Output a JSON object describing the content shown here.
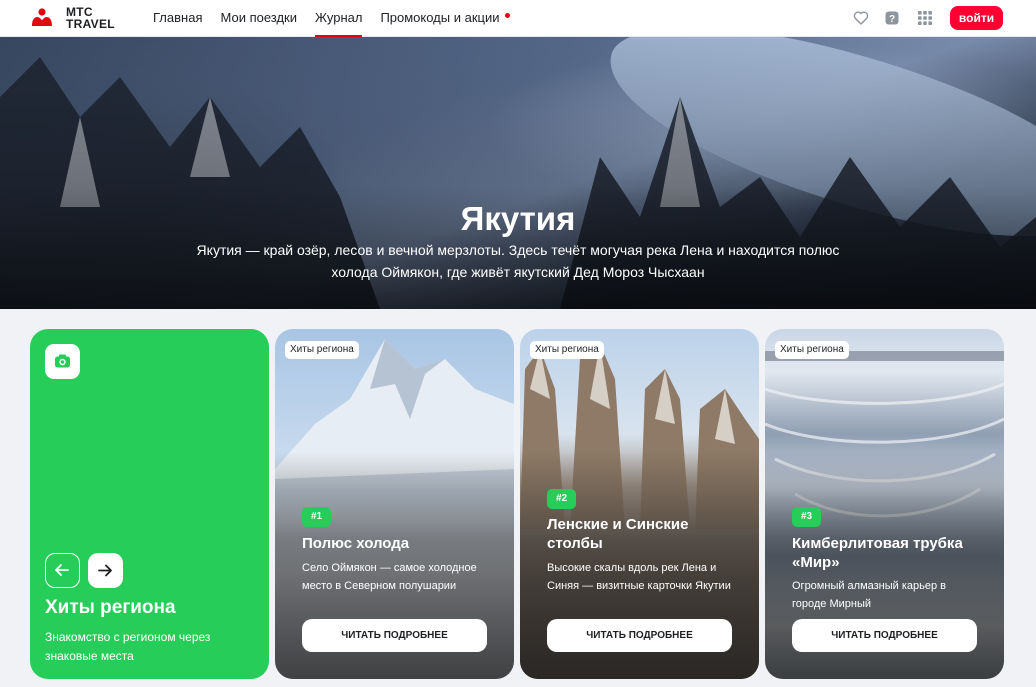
{
  "header": {
    "logo_text_line1": "МТС",
    "logo_text_line2": "TRAVEL",
    "nav": [
      {
        "label": "Главная",
        "active": false
      },
      {
        "label": "Мои поездки",
        "active": false
      },
      {
        "label": "Журнал",
        "active": true
      },
      {
        "label": "Промокоды и акции",
        "active": false,
        "dot": true
      }
    ],
    "icons": [
      "heart-icon",
      "help-icon",
      "apps-grid-icon"
    ],
    "login_label": "войти",
    "accent": "#ff0032"
  },
  "hero": {
    "title": "Якутия",
    "description": "Якутия — край озёр, лесов и вечной мерзлоты. Здесь течёт могучая река Лена и находится полюс холода Оймякон, где живёт якутский Дед Мороз Чысхаан"
  },
  "intro_card": {
    "icon": "camera-icon",
    "title": "Хиты региона",
    "subtitle": "Знакомство с регионом через знаковые места",
    "color": "#26cd58"
  },
  "cards": [
    {
      "tag": "Хиты региона",
      "number": "#1",
      "title": "Полюс холода",
      "description": "Село Оймякон — самое холодное место в Северном полушарии",
      "button": "ЧИТАТЬ ПОДРОБНЕЕ"
    },
    {
      "tag": "Хиты региона",
      "number": "#2",
      "title": "Ленские и Синские столбы",
      "description": "Высокие скалы вдоль рек Лена и Синяя — визитные карточки Якутии",
      "button": "ЧИТАТЬ ПОДРОБНЕЕ"
    },
    {
      "tag": "Хиты региона",
      "number": "#3",
      "title": "Кимберлитовая трубка «Мир»",
      "description": "Огромный алмазный карьер в городе Мирный",
      "button": "ЧИТАТЬ ПОДРОБНЕЕ"
    }
  ]
}
